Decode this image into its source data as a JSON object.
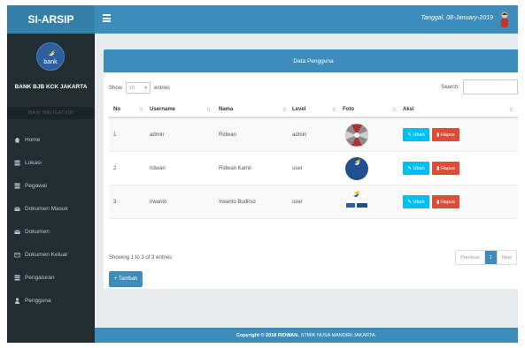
{
  "app": {
    "brand": "SI-ARSIP",
    "date": "Tanggal, 08-January-2019"
  },
  "sidebar": {
    "logo_text": "bank",
    "org_name": "BANK BJB KCK JAKARTA",
    "nav_header": "MAIN NAVIGATION",
    "items": [
      {
        "label": "Home",
        "icon": "home-icon"
      },
      {
        "label": "Lokasi",
        "icon": "table-icon"
      },
      {
        "label": "Pegawai",
        "icon": "list-icon"
      },
      {
        "label": "Dokumen Masuk",
        "icon": "envelope-icon"
      },
      {
        "label": "Dokumen",
        "icon": "envelope-icon"
      },
      {
        "label": "Dokumen Keluar",
        "icon": "envelope-open-icon"
      },
      {
        "label": "Pengaturan",
        "icon": "list-icon"
      },
      {
        "label": "Pengguna",
        "icon": "user-icon"
      }
    ]
  },
  "panel": {
    "title": "Data Pengguna",
    "show_label": "Show",
    "show_value": "10",
    "entries_label": "entries",
    "search_label": "Search:",
    "columns": [
      "No",
      "Username",
      "Nama",
      "Level",
      "Foto",
      "Aksi"
    ],
    "rows": [
      {
        "no": "1",
        "username": "admin",
        "nama": "Ridwan",
        "level": "admin",
        "foto": "photo-icon"
      },
      {
        "no": "2",
        "username": "ridwan",
        "nama": "Ridwan Kamil",
        "level": "user",
        "foto": "bank-bjb-logo-round"
      },
      {
        "no": "3",
        "username": "irwanto",
        "nama": "Irwanto Budirso",
        "level": "user",
        "foto": "bank-bjb-logo"
      }
    ],
    "btn_edit": "Ubah",
    "btn_delete": "Hapus",
    "info": "Showing 1 to 3 of 3 entries",
    "pager": {
      "prev": "Previous",
      "current": "1",
      "next": "Next"
    },
    "add_label": "Tambah"
  },
  "footer": {
    "strong": "Copyright © 2018 RIDWAN.",
    "rest": "STMIK NUSA MANDIRI JAKARTA."
  },
  "colors": {
    "primary": "#3c8dbc",
    "sidebar": "#222d32",
    "info": "#00c0ef",
    "danger": "#dd4b39"
  }
}
